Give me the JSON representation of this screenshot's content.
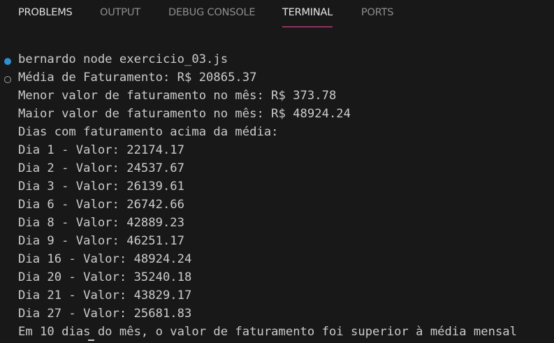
{
  "tabs": [
    {
      "label": "PROBLEMS",
      "active": false
    },
    {
      "label": "OUTPUT",
      "active": false
    },
    {
      "label": "DEBUG CONSOLE",
      "active": false
    },
    {
      "label": "TERMINAL",
      "active": true
    },
    {
      "label": "PORTS",
      "active": false
    }
  ],
  "terminal": {
    "command": {
      "prompt": "bernardo",
      "text": "node exercicio_03.js",
      "full": "bernardo node exercicio_03.js"
    },
    "output": [
      "Média de Faturamento: R$ 20865.37",
      "Menor valor de faturamento no mês: R$ 373.78",
      "Maior valor de faturamento no mês: R$ 48924.24",
      "Dias com faturamento acima da média:",
      "Dia 1 - Valor: 22174.17",
      "Dia 2 - Valor: 24537.67",
      "Dia 3 - Valor: 26139.61",
      "Dia 6 - Valor: 26742.66",
      "Dia 8 - Valor: 42889.23",
      "Dia 9 - Valor: 46251.17",
      "Dia 16 - Valor: 48924.24",
      "Dia 20 - Valor: 35240.18",
      "Dia 21 - Valor: 43829.17",
      "Dia 27 - Valor: 25681.83",
      "Em 10 dias do mês, o valor de faturamento foi superior à média mensal"
    ]
  },
  "colors": {
    "background": "#181818",
    "text": "#cccccc",
    "tab_inactive": "#8e8e8e",
    "tab_active": "#e7e7e7",
    "tab_active_underline": "#f14c9e",
    "success_decoration": "#2f8fd1",
    "pending_decoration": "#a0a0a0"
  }
}
